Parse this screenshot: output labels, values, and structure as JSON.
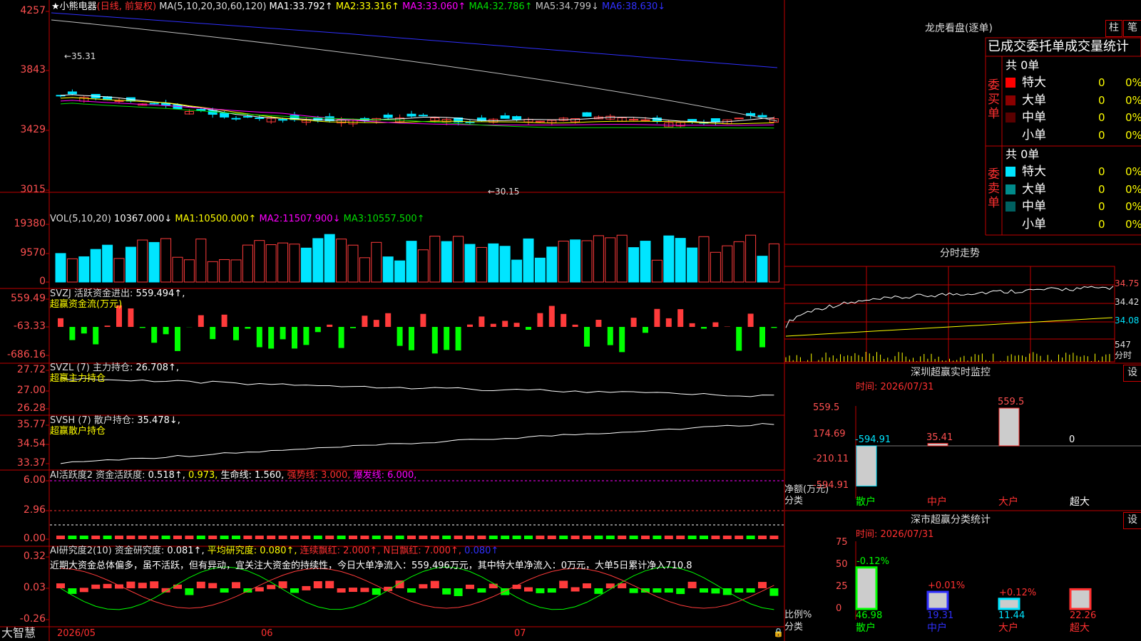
{
  "colors": {
    "up": "#ff3b3b",
    "down": "#00e5ff",
    "ma1": "#ffffff",
    "ma2": "#ffff00",
    "ma3": "#ff00ff",
    "ma4": "#00dd00",
    "ma5": "#c0c0c0",
    "ma6": "#3030ff",
    "yellow": "#ffff00",
    "green": "#00ff00",
    "red": "#ff3030",
    "frame": "#c00000",
    "axis": "#ff5050"
  },
  "kline": {
    "title": "小熊电器",
    "subtitle": "(日线, 前复权)",
    "ma_label": "MA(5,10,20,30,60,120)",
    "ma": [
      {
        "n": "MA1:",
        "v": "33.792↑"
      },
      {
        "n": "MA2:",
        "v": "33.316↑"
      },
      {
        "n": "MA3:",
        "v": "33.060↑"
      },
      {
        "n": "MA4:",
        "v": "32.786↑"
      },
      {
        "n": "MA5:",
        "v": "34.799↓"
      },
      {
        "n": "MA6:",
        "v": "38.630↓"
      }
    ],
    "yticks": [
      "4257",
      "3843",
      "3429",
      "3015"
    ],
    "high_label": "←35.31",
    "low_label": "←30.15"
  },
  "vol": {
    "label": "VOL(5,10,20)",
    "val": "10367.000↓",
    "ma": [
      {
        "n": "MA1:",
        "v": "10500.000↑"
      },
      {
        "n": "MA2:",
        "v": "11507.900↓"
      },
      {
        "n": "MA3:",
        "v": "10557.500↑"
      }
    ],
    "yticks": [
      "19380",
      "9570",
      "0"
    ]
  },
  "svzj": {
    "label": "SVZJ  活跃资金进出:",
    "val": "559.494↑,",
    "sub": "超赢资金流(万元)",
    "yticks": [
      "559.49",
      "-63.33",
      "-686.16"
    ]
  },
  "svzl": {
    "label": "SVZL (7) 主力持仓:",
    "val": "26.708↑,",
    "sub": "超赢主力持仓",
    "yticks": [
      "27.72",
      "27.00",
      "26.28"
    ]
  },
  "svsh": {
    "label": "SVSH (7) 散户持仓:",
    "val": "35.478↓,",
    "sub": "超赢散户持仓",
    "yticks": [
      "35.77",
      "34.54",
      "33.37"
    ]
  },
  "ai1": {
    "label": "AI活跃度2 资金活跃度:",
    "v1": "0.518↑,",
    "v2": "0.973,",
    "v3": "生命线: 1.560,",
    "v4": "强势线: 3.000,",
    "v5": "爆发线: 6.000,",
    "yticks": [
      "6.00",
      "2.96",
      "0.00"
    ]
  },
  "ai2": {
    "label": "AI研究度2(10) 资金研究度:",
    "v1": "0.081↑,",
    "v2": "平均研究度: 0.080↑,",
    "v3": "连续飘红: 2.000↑,",
    "v4": "N日飘红: 7.000↑,",
    "v5": "0.080↑",
    "comment": "近期大资金总体偏多，虽不活跃，但有异动，宜关注大资金的持续性，今日大单净流入：559.496万元，其中特大单净流入：0万元，大单5日累计净入710.8",
    "yticks": [
      "0.32",
      "0.03",
      "-0.26"
    ]
  },
  "xaxis": {
    "app": "大智慧",
    "labels": [
      "2026/05",
      "06",
      "07"
    ]
  },
  "dragon": {
    "title": "龙虎看盘(逐单)",
    "btn1": "柱",
    "btn2": "笔",
    "header": "已成交委托单成交量统计",
    "buy": {
      "side": "委买单",
      "total": "共 0单",
      "rows": [
        {
          "name": "特大",
          "v": "0",
          "p": "0%"
        },
        {
          "name": "大单",
          "v": "0",
          "p": "0%"
        },
        {
          "name": "中单",
          "v": "0",
          "p": "0%"
        },
        {
          "name": "小单",
          "v": "0",
          "p": "0%"
        }
      ]
    },
    "sell": {
      "side": "委卖单",
      "total": "共 0单",
      "rows": [
        {
          "name": "特大",
          "v": "0",
          "p": "0%"
        },
        {
          "name": "大单",
          "v": "0",
          "p": "0%"
        },
        {
          "name": "中单",
          "v": "0",
          "p": "0%"
        },
        {
          "name": "小单",
          "v": "0",
          "p": "0%"
        }
      ]
    }
  },
  "intraday": {
    "title": "分时走势",
    "yticks": [
      "34.75",
      "34.42",
      "34.08"
    ],
    "vol": "547",
    "unit": "分时"
  },
  "monitor": {
    "title": "深圳超赢实时监控",
    "btn": "设",
    "time": "时间: 2026/07/31",
    "yticks": [
      "559.5",
      "174.69",
      "-210.11",
      "-594.91"
    ],
    "unit1": "净额(万元)",
    "unit2": "分类",
    "cats": [
      "散户",
      "中户",
      "大户",
      "超大"
    ],
    "values": [
      "-594.91",
      "35.41",
      "559.5",
      "0"
    ]
  },
  "stats": {
    "title": "深市超赢分类统计",
    "btn": "设",
    "time": "时间: 2026/07/31",
    "yticks": [
      "75",
      "50",
      "25",
      "0"
    ],
    "unit1": "比例%",
    "unit2": "分类",
    "cats": [
      "散户",
      "中户",
      "大户",
      "超大"
    ],
    "values": [
      "46.98",
      "19.31",
      "11.44",
      "22.26"
    ],
    "changes": [
      "-0.12%",
      "+0.01%",
      "+0.12%",
      ""
    ]
  },
  "chart_data": [
    {
      "type": "bar",
      "title": "深圳超赢实时监控",
      "ylabel": "净额(万元)",
      "categories": [
        "散户",
        "中户",
        "大户",
        "超大"
      ],
      "values": [
        -594.91,
        35.41,
        559.5,
        0
      ],
      "ylim": [
        -594.91,
        559.5
      ]
    },
    {
      "type": "bar",
      "title": "深市超赢分类统计",
      "ylabel": "比例%",
      "categories": [
        "散户",
        "中户",
        "大户",
        "超大"
      ],
      "values": [
        46.98,
        19.31,
        11.44,
        22.26
      ],
      "ylim": [
        0,
        75
      ]
    }
  ]
}
